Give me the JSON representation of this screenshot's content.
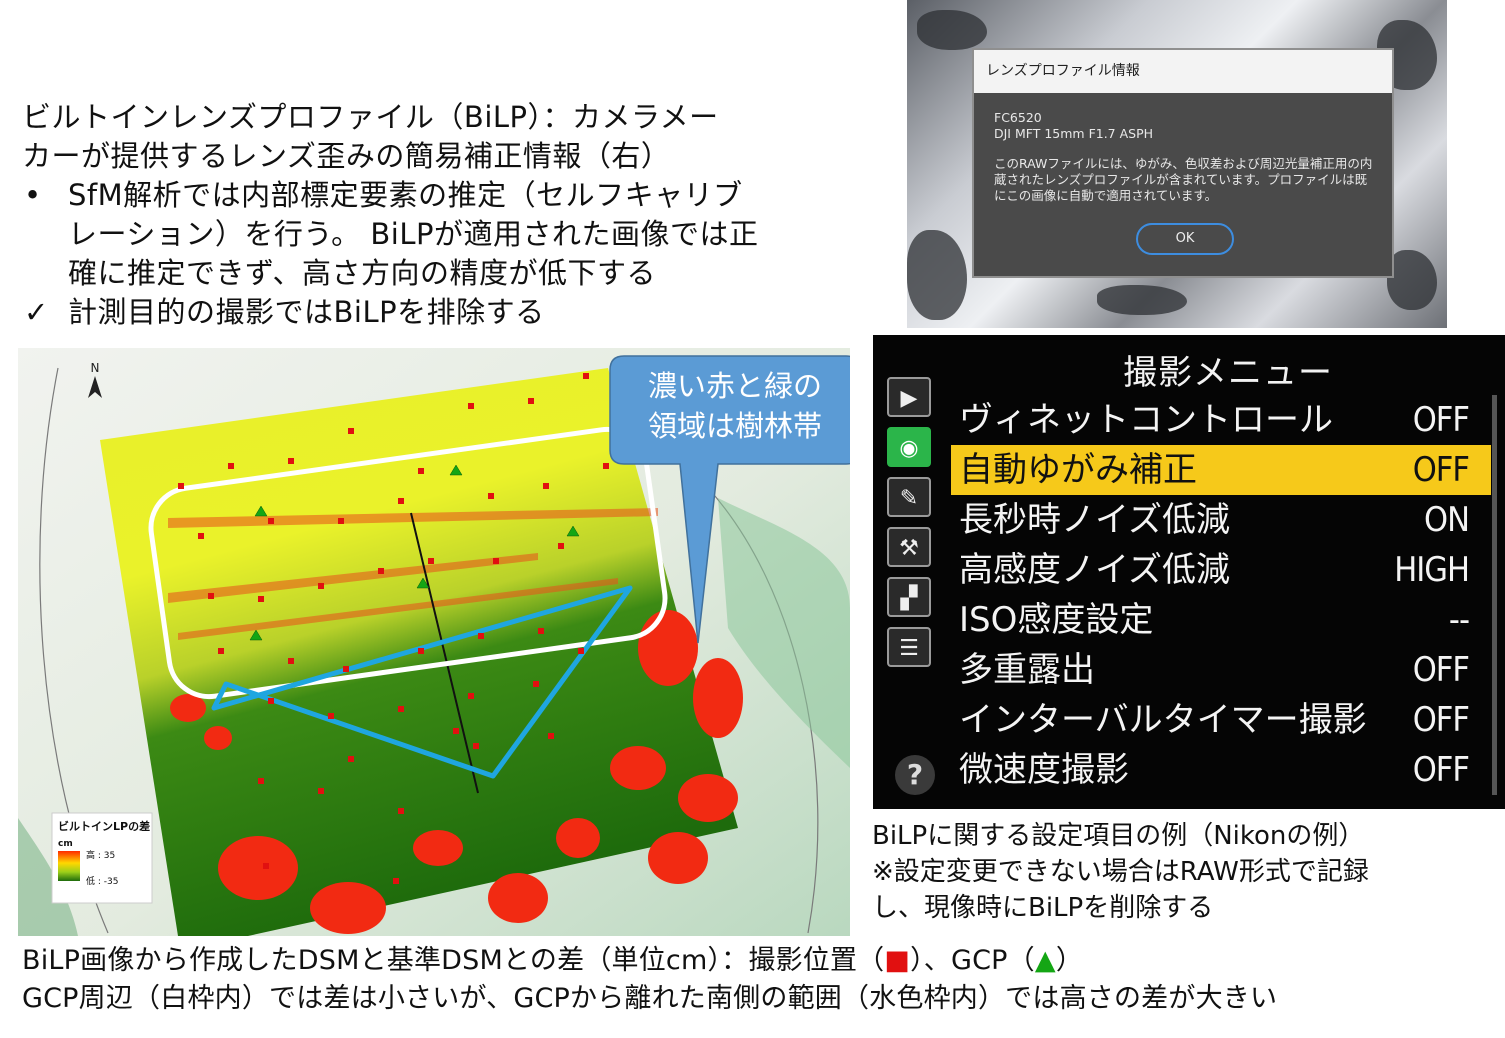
{
  "intro": {
    "line1": "ビルトインレンズプロファイル（BiLP）：カメラメー",
    "line2": "カーが提供するレンズ歪みの簡易補正情報（右）",
    "bullet_mark": "•",
    "bullet_line1": "SfM解析では内部標定要素の推定（セルフキャリブ",
    "bullet_line2": "レーション）を行う。 BiLPが適用された画像では正",
    "bullet_line3": "確に推定できず、高さ方向の精度が低下する",
    "check_mark": "✓",
    "check_line": "計測目的の撮影ではBiLPを排除する"
  },
  "dialog": {
    "title": "レンズプロファイル情報",
    "model": "FC6520",
    "lens": "DJI MFT 15mm F1.7 ASPH",
    "message": "このRAWファイルには、ゆがみ、色収差および周辺光量補正用の内蔵されたレンズプロファイルが含まれています。プロファイルは既にこの画像に自動で適用されています。",
    "ok_label": "OK"
  },
  "menu": {
    "title": "撮影メニュー",
    "help_label": "?",
    "items": [
      {
        "label": "ヴィネットコントロール",
        "value": "OFF"
      },
      {
        "label": "自動ゆがみ補正",
        "value": "OFF"
      },
      {
        "label": "長秒時ノイズ低減",
        "value": "ON"
      },
      {
        "label": "高感度ノイズ低減",
        "value": "HIGH"
      },
      {
        "label": "ISO感度設定",
        "value": "--"
      },
      {
        "label": "多重露出",
        "value": "OFF"
      },
      {
        "label": "インターバルタイマー撮影",
        "value": "OFF"
      },
      {
        "label": "微速度撮影",
        "value": "OFF"
      }
    ]
  },
  "menu_caption": {
    "line1": "BiLPに関する設定項目の例（Nikonの例）",
    "line2": "※設定変更できない場合はRAW形式で記録",
    "line3": "し、現像時にBiLPを削除する"
  },
  "map": {
    "north_label": "N",
    "callout_line1": "濃い赤と緑の",
    "callout_line2": "領域は樹林帯",
    "legend_title": "ビルトインLPの差",
    "legend_unit": "cm",
    "legend_high": "高 : 35",
    "legend_low": "低 : -35"
  },
  "bottom": {
    "line1_a": "BiLP画像から作成したDSMと基準DSMとの差（単位cm）：撮影位置（",
    "line1_sq": "■",
    "line1_b": "）、GCP（",
    "line1_tri": "▲",
    "line1_c": "）",
    "line2": "GCP周辺（白枠内）では差は小さいが、GCPから離れた南側の範囲（水色枠内）では高さの差が大きい"
  },
  "colors": {
    "highlight": "#f6c91a",
    "callout": "#5b9bd5",
    "white_frame": "#ffffff",
    "cyan_frame": "#1fa6e0",
    "marker_red": "#e11010",
    "marker_green": "#14a614"
  }
}
